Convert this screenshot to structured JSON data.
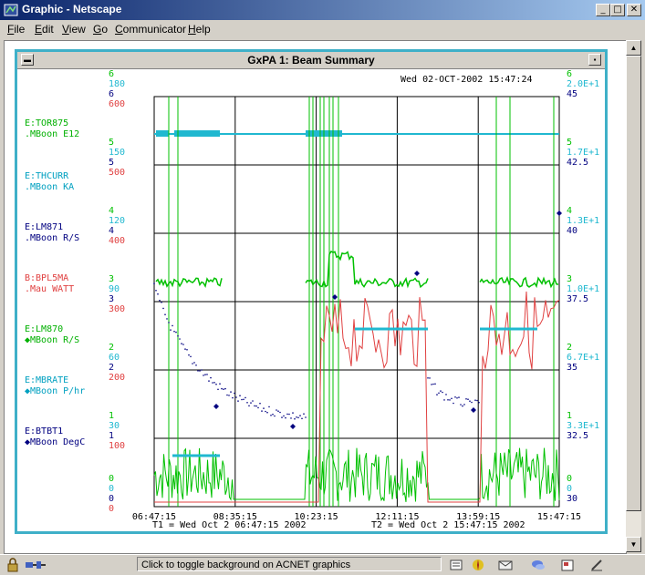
{
  "window": {
    "title": "Graphic - Netscape",
    "controls": [
      "minimize",
      "maximize",
      "close"
    ]
  },
  "menu": {
    "items": [
      {
        "label": "File",
        "key": "F"
      },
      {
        "label": "Edit",
        "key": "E"
      },
      {
        "label": "View",
        "key": "V"
      },
      {
        "label": "Go",
        "key": "G"
      },
      {
        "label": "Communicator",
        "key": "C"
      },
      {
        "label": "Help",
        "key": "H"
      }
    ]
  },
  "panel": {
    "title": "GxPA 1: Beam Summary",
    "timestamp": "Wed 02-OCT-2002 15:47:24"
  },
  "legend": [
    {
      "device": "E:TOR875",
      "desc": ".MBoon E12",
      "color": "#00b000"
    },
    {
      "device": "E:THCURR",
      "desc": ".MBoon KA",
      "color": "#00a0c0"
    },
    {
      "device": "E:LM871",
      "desc": ".MBoon R/S",
      "color": "#000080"
    },
    {
      "device": "B:BPL5MA",
      "desc": ".Mau   WATT",
      "color": "#e04040"
    },
    {
      "device": "E:LM870",
      "desc": "◆MBoon R/S",
      "color": "#00b000"
    },
    {
      "device": "E:MBRATE",
      "desc": "◆MBoon P/hr",
      "color": "#00a0c0"
    },
    {
      "device": "E:BTBT1",
      "desc": "◆MBoon DegC",
      "color": "#000080"
    }
  ],
  "left_axes": {
    "green": [
      "6",
      "5",
      "4",
      "3",
      "2",
      "1",
      "0"
    ],
    "cyan": [
      "180",
      "150",
      "120",
      "90",
      "60",
      "30",
      "0"
    ],
    "navy": [
      "6",
      "5",
      "4",
      "3",
      "2",
      "1",
      "0"
    ],
    "red": [
      "600",
      "500",
      "400",
      "300",
      "200",
      "100",
      "0"
    ]
  },
  "right_axes": {
    "green": [
      "6",
      "5",
      "4",
      "3",
      "2",
      "1",
      "0"
    ],
    "cyan": [
      "2.0E+1",
      "1.7E+1",
      "1.3E+1",
      "1.0E+1",
      "6.7E+1",
      "3.3E+1",
      "0"
    ],
    "navy": [
      "45",
      "42.5",
      "40",
      "37.5",
      "35",
      "32.5",
      "30"
    ]
  },
  "time_axis": {
    "ticks": [
      "06:47:15",
      "08:35:15",
      "10:23:15",
      "12:11:15",
      "13:59:15",
      "15:47:15"
    ],
    "t1": "T1 = Wed Oct  2 06:47:15 2002",
    "t2": "T2 = Wed Oct  2 15:47:15 2002"
  },
  "status": {
    "message": "Click to toggle background on ACNET graphics"
  },
  "colors": {
    "green": "#00c000",
    "cyan": "#20b8d0",
    "navy": "#000080",
    "red": "#e04040",
    "frame": "#3fb0c8"
  }
}
